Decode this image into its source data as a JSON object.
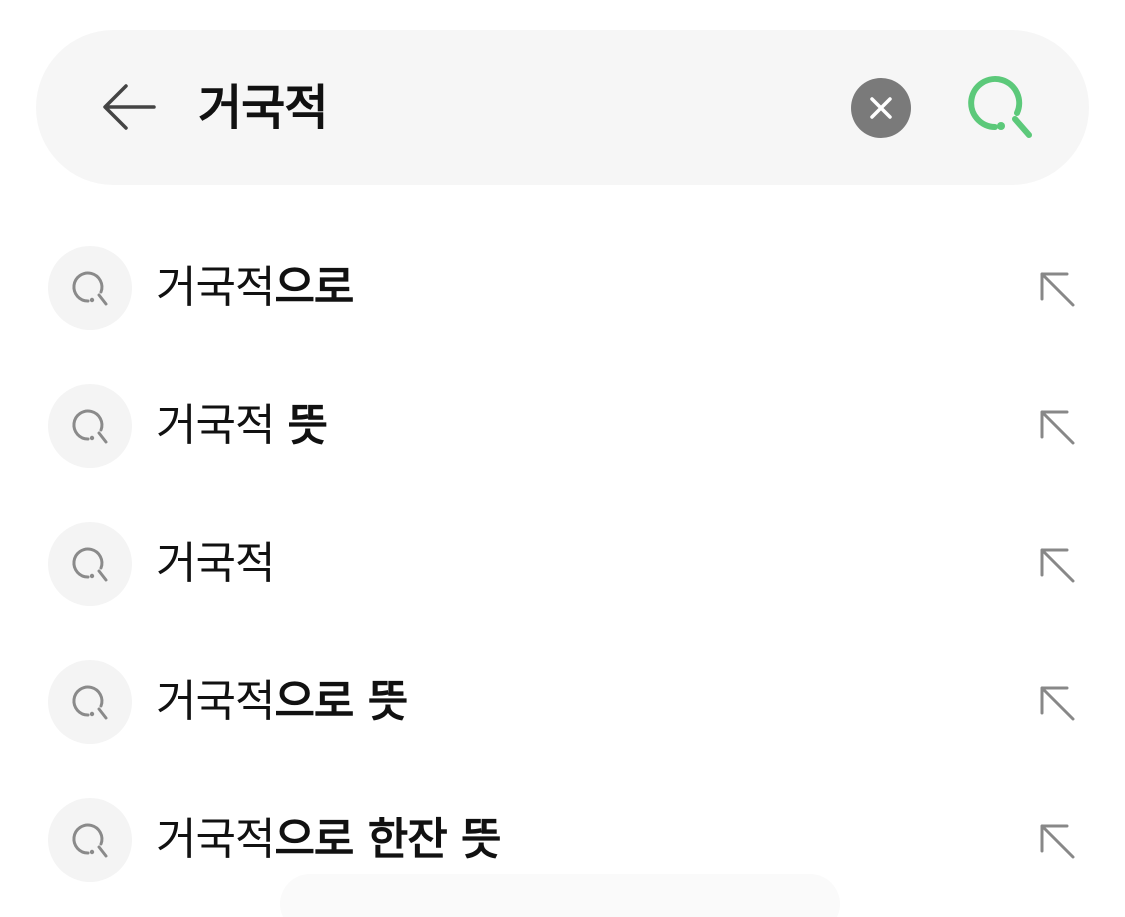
{
  "search": {
    "query": "거국적",
    "colors": {
      "accent": "#5cc97a",
      "clear_bg": "#7a7a7a",
      "bar_bg": "#f6f6f6"
    },
    "icons": {
      "back": "arrow-left-icon",
      "clear": "close-icon",
      "submit": "search-icon"
    }
  },
  "suggestions": [
    {
      "typed": "거국적",
      "completion": "으로"
    },
    {
      "typed": "거국적 ",
      "completion": "뜻"
    },
    {
      "typed": "거국적",
      "completion": ""
    },
    {
      "typed": "거국적",
      "completion": "으로 뜻"
    },
    {
      "typed": "거국적",
      "completion": "으로 한잔 뜻"
    }
  ],
  "suggestion_icons": {
    "leading": "search-icon",
    "trailing": "arrow-up-left-icon"
  }
}
